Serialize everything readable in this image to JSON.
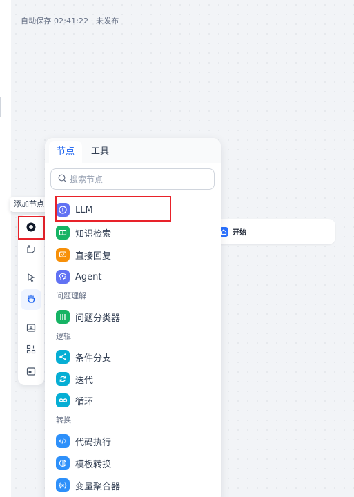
{
  "header": {
    "autosave_text": "自动保存 02:41:22 · 未发布"
  },
  "canvas": {
    "start_node_label": "开始"
  },
  "toolbar": {
    "tooltip": "添加节点",
    "buttons": [
      {
        "name": "add-node-button",
        "icon": "plus-circle-icon"
      },
      {
        "name": "add-note-button",
        "icon": "note-icon"
      },
      {
        "name": "pointer-mode-button",
        "icon": "cursor-icon"
      },
      {
        "name": "hand-mode-button",
        "icon": "hand-icon",
        "active": true
      },
      {
        "name": "export-image-button",
        "icon": "export-image-icon"
      },
      {
        "name": "organize-nodes-button",
        "icon": "grid-icon"
      },
      {
        "name": "minimap-button",
        "icon": "minimap-icon"
      }
    ]
  },
  "panel": {
    "tabs": [
      {
        "label": "节点",
        "active": true
      },
      {
        "label": "工具",
        "active": false
      }
    ],
    "search_placeholder": "搜索节点",
    "items": [
      {
        "label": "LLM",
        "icon": "llm-icon",
        "color": "#6172f3"
      },
      {
        "label": "知识检索",
        "icon": "knowledge-icon",
        "color": "#16b364"
      },
      {
        "label": "直接回复",
        "icon": "reply-icon",
        "color": "#f79009"
      },
      {
        "label": "Agent",
        "icon": "agent-icon",
        "color": "#6172f3"
      }
    ],
    "sections": [
      {
        "title": "问题理解",
        "items": [
          {
            "label": "问题分类器",
            "icon": "classifier-icon",
            "color": "#16b364"
          }
        ]
      },
      {
        "title": "逻辑",
        "items": [
          {
            "label": "条件分支",
            "icon": "branch-icon",
            "color": "#06aed4"
          },
          {
            "label": "迭代",
            "icon": "iteration-icon",
            "color": "#06aed4"
          },
          {
            "label": "循环",
            "icon": "loop-icon",
            "color": "#06aed4"
          }
        ]
      },
      {
        "title": "转换",
        "items": [
          {
            "label": "代码执行",
            "icon": "code-icon",
            "color": "#2e90fa"
          },
          {
            "label": "模板转换",
            "icon": "template-icon",
            "color": "#2e90fa"
          },
          {
            "label": "变量聚合器",
            "icon": "variable-aggregator-icon",
            "color": "#2e90fa"
          }
        ]
      }
    ]
  }
}
